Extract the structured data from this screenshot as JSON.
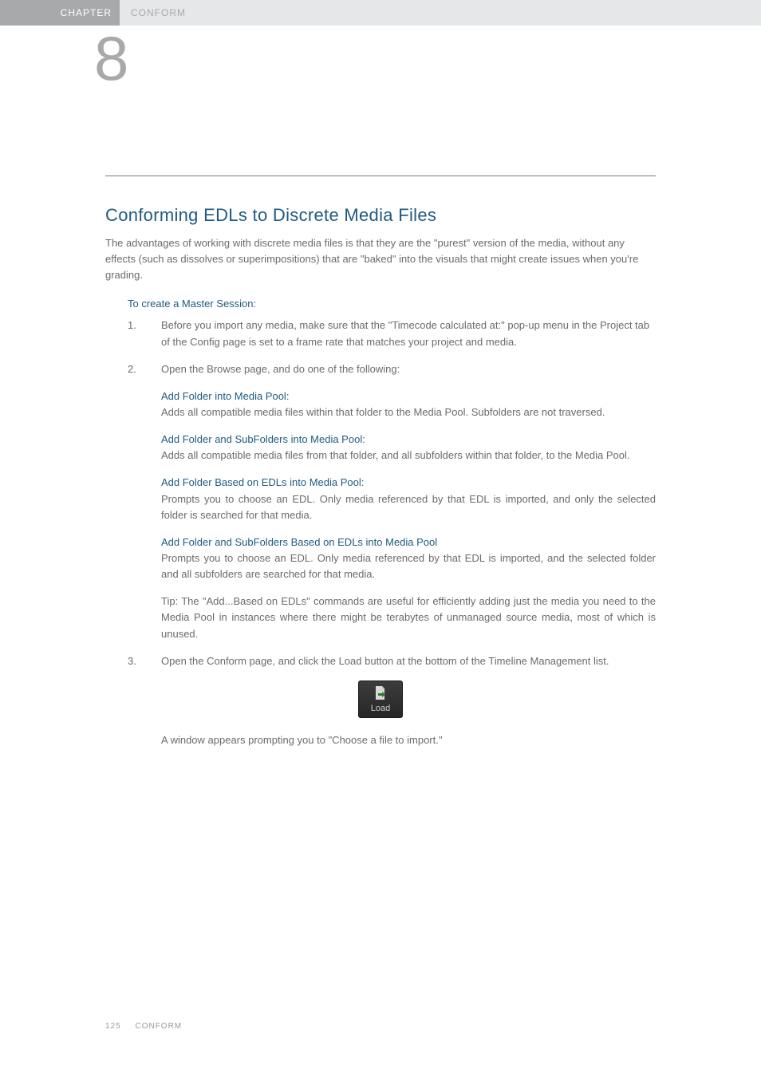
{
  "header": {
    "chapter_label": "CHAPTER",
    "title": "CONFORM",
    "chapter_number": "8"
  },
  "h1": "Conforming EDLs to Discrete Media Files",
  "intro": "The advantages of working with discrete media files is that they are the \"purest\" version of the media, without any effects (such as dissolves or superimpositions) that are \"baked\" into the visuals that might create issues when you're grading.",
  "section_sub": "To create a Master Session:",
  "steps": [
    {
      "num": "1.",
      "text": "Before you import any media, make sure that the \"Timecode calculated at:\" pop-up menu in the Project tab of the Config page is set to a frame rate that matches your project and media."
    },
    {
      "num": "2.",
      "text": "Open the Browse page, and do one of the following:"
    }
  ],
  "defs": [
    {
      "title": "Add Folder into Media Pool:",
      "body": "Adds all compatible media files within that folder to the Media Pool. Subfolders are not traversed."
    },
    {
      "title": "Add Folder and SubFolders into Media Pool:",
      "body": "Adds all compatible media files from that folder, and all subfolders within that folder, to the Media Pool."
    },
    {
      "title": "Add Folder Based on EDLs into Media Pool:",
      "body": "Prompts you to choose an EDL. Only media referenced by that EDL is imported, and only the selected folder is searched for that media."
    },
    {
      "title": "Add Folder and SubFolders Based on EDLs into Media Pool",
      "body": "Prompts you to choose an EDL. Only media referenced by that EDL is imported, and the selected folder and all subfolders are searched for that media."
    }
  ],
  "tip": "Tip: The \"Add...Based on EDLs\" commands are useful for efficiently adding just the media you need to the Media Pool in instances where there might be terabytes of unmanaged source media, most of which is unused.",
  "step3": {
    "num": "3.",
    "text": "Open the Conform page, and click the Load button at the bottom of the Timeline Management list."
  },
  "load_button_label": "Load",
  "after_img": "A window appears prompting you to \"Choose a file to import.\"",
  "footer": {
    "page_number": "125",
    "section": "CONFORM"
  }
}
